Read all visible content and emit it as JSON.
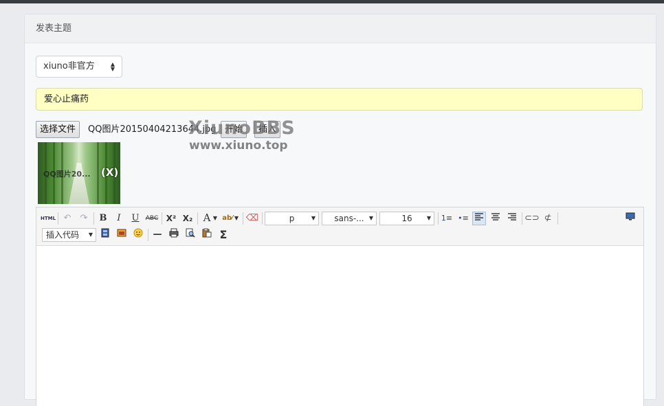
{
  "header": {
    "title": "发表主题"
  },
  "forum_select": {
    "value": "xiuno非官方"
  },
  "title_input": {
    "value": "爱心止痛药"
  },
  "upload": {
    "choose_file_label": "选择文件",
    "file_name": "QQ图片20150404213644.jpg",
    "start_label": "开始",
    "insert_label": "插入"
  },
  "watermark": {
    "brand": "XiunoBBS",
    "url": "www.xiuno.top"
  },
  "thumbnail": {
    "caption": "QQ图片20...",
    "remove_label": "(X)"
  },
  "toolbar": {
    "html_label": "HTML",
    "bold": "B",
    "italic": "I",
    "underline": "U",
    "strike": "ABC",
    "superscript": "X²",
    "subscript": "X₂",
    "font_color": "A",
    "paragraph_value": "p",
    "font_family_value": "sans-...",
    "font_size_value": "16",
    "insert_code_label": "插入代码",
    "hr_symbol": "—",
    "formula_symbol": "Σ",
    "icons": [
      "undo-icon",
      "redo-icon",
      "highlight-icon",
      "eraser-icon",
      "ordered-list-icon",
      "unordered-list-icon",
      "align-left-icon",
      "align-center-icon",
      "align-right-icon",
      "link-icon",
      "unlink-icon",
      "fullscreen-icon",
      "video-icon",
      "image-icon",
      "emoticon-icon",
      "print-icon",
      "preview-icon",
      "paste-icon"
    ]
  },
  "colors": {
    "title_bg": "#ffffc4",
    "active_button": "#dbe6f4",
    "top_bar": "#3a3d42"
  }
}
